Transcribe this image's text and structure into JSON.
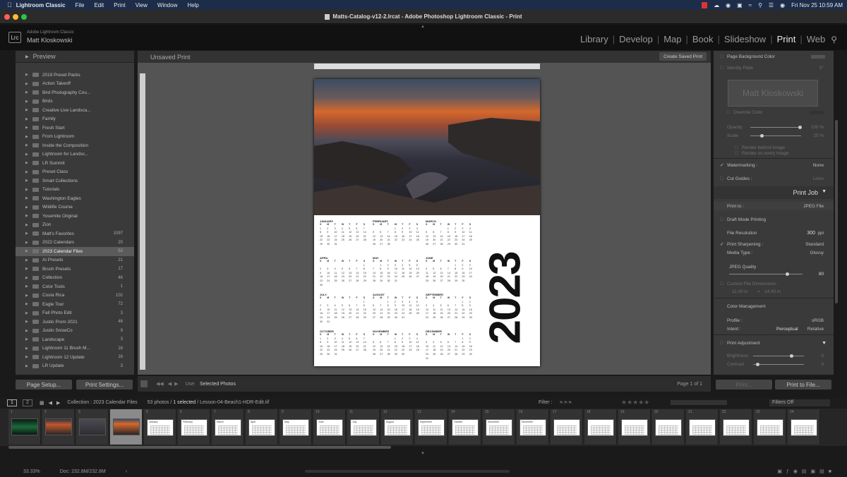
{
  "menubar": {
    "app": "Lightroom Classic",
    "items": [
      "File",
      "Edit",
      "Print",
      "View",
      "Window",
      "Help"
    ],
    "datetime": "Fri Nov 25  10:59 AM"
  },
  "window": {
    "title": "Matts-Catalog-v12-2.lrcat - Adobe Photoshop Lightroom Classic - Print"
  },
  "identity": {
    "badge": "Lrc",
    "product": "Adobe Lightroom Classic",
    "user": "Matt Kloskowski"
  },
  "modules": [
    "Library",
    "Develop",
    "Map",
    "Book",
    "Slideshow",
    "Print",
    "Web"
  ],
  "active_module": "Print",
  "left": {
    "header": "Preview",
    "collections": [
      {
        "name": "2019 Preset Packs",
        "count": ""
      },
      {
        "name": "Action Takeoff",
        "count": ""
      },
      {
        "name": "Bird Photography Cou...",
        "count": ""
      },
      {
        "name": "Birds",
        "count": ""
      },
      {
        "name": "Creative Live Landsca...",
        "count": ""
      },
      {
        "name": "Family",
        "count": ""
      },
      {
        "name": "Fresh Start",
        "count": ""
      },
      {
        "name": "From Lightroom",
        "count": ""
      },
      {
        "name": "Inside the Composition",
        "count": ""
      },
      {
        "name": "Lightroom for Landsc...",
        "count": ""
      },
      {
        "name": "LR Summit",
        "count": ""
      },
      {
        "name": "Preset Class",
        "count": ""
      },
      {
        "name": "Smart Collections",
        "count": ""
      },
      {
        "name": "Tutorials",
        "count": ""
      },
      {
        "name": "Washington Eagles",
        "count": ""
      },
      {
        "name": "Wildlife Course",
        "count": ""
      },
      {
        "name": "Yosemite Original",
        "count": ""
      },
      {
        "name": "Zion",
        "count": ""
      },
      {
        "name": "Matt's Favorites",
        "count": "1097"
      },
      {
        "name": "2022 Calendars",
        "count": "20"
      },
      {
        "name": "2023 Calendar Files",
        "count": "53"
      },
      {
        "name": "AI Presets",
        "count": "21"
      },
      {
        "name": "Brush Presets",
        "count": "17"
      },
      {
        "name": "Collection",
        "count": "46"
      },
      {
        "name": "Color Tools",
        "count": "1"
      },
      {
        "name": "Costa Rica",
        "count": "102"
      },
      {
        "name": "Eagle Tour",
        "count": "72"
      },
      {
        "name": "Fall Photo Edit",
        "count": "3"
      },
      {
        "name": "Justin Prom 2021",
        "count": "46"
      },
      {
        "name": "Justin SnowCo",
        "count": "9"
      },
      {
        "name": "Landscape",
        "count": "3"
      },
      {
        "name": "Lightroom 11 Brush M...",
        "count": "16"
      },
      {
        "name": "Lightroom 12 Update",
        "count": "16"
      },
      {
        "name": "LR Update",
        "count": "3"
      }
    ],
    "selected_index": 20,
    "page_setup": "Page Setup...",
    "print_settings": "Print Settings..."
  },
  "center": {
    "title": "Unsaved Print",
    "create_saved": "Create Saved Print",
    "year": "2023",
    "weekdays": [
      "S",
      "M",
      "T",
      "W",
      "T",
      "F",
      "S"
    ],
    "months": [
      {
        "name": "JANUARY",
        "start": 0,
        "days": 31
      },
      {
        "name": "FEBRUARY",
        "start": 3,
        "days": 28
      },
      {
        "name": "MARCH",
        "start": 3,
        "days": 31
      },
      {
        "name": "APRIL",
        "start": 6,
        "days": 30
      },
      {
        "name": "MAY",
        "start": 1,
        "days": 31
      },
      {
        "name": "JUNE",
        "start": 4,
        "days": 30
      },
      {
        "name": "JULY",
        "start": 6,
        "days": 31
      },
      {
        "name": "AUGUST",
        "start": 2,
        "days": 31
      },
      {
        "name": "SEPTEMBER",
        "start": 5,
        "days": 30
      },
      {
        "name": "OCTOBER",
        "start": 0,
        "days": 31
      },
      {
        "name": "NOVEMBER",
        "start": 3,
        "days": 30
      },
      {
        "name": "DECEMBER",
        "start": 5,
        "days": 31
      }
    ],
    "use_label": "Use:",
    "use_value": "Selected Photos",
    "page_info": "Page 1 of 1"
  },
  "right": {
    "page_bg": "Page Background Color",
    "identity_plate": "Identity Plate",
    "identity_plate_angle": "0°",
    "plate_text": "Matt Kloskowski",
    "override_color": "Override Color",
    "opacity_label": "Opacity",
    "opacity_value": "100 %",
    "scale_label": "Scale",
    "scale_value": "25 %",
    "render_behind": "Render behind image",
    "render_every": "Render on every image",
    "watermarking": "Watermarking :",
    "watermark_value": "None",
    "cut_guides": "Cut Guides :",
    "cut_guides_value": "Lines",
    "print_job": "Print Job",
    "print_to_label": "Print to :",
    "print_to_value": "JPEG File",
    "draft_mode": "Draft Mode Printing",
    "file_resolution": "File Resolution",
    "file_resolution_value": "300",
    "file_resolution_unit": "ppi",
    "print_sharpening": "Print Sharpening :",
    "print_sharpening_value": "Standard",
    "media_type": "Media Type :",
    "media_type_value": "Glossy",
    "jpeg_quality": "JPEG Quality",
    "jpeg_quality_value": "80",
    "jpeg_quality_fraction": 0.8,
    "custom_dims": "Custom File Dimensions :",
    "custom_w": "11.00 in",
    "custom_x": "×",
    "custom_h": "14.00 in",
    "color_management": "Color Management",
    "profile_label": "Profile :",
    "profile_value": "sRGB",
    "intent_label": "Intent :",
    "intent_perceptual": "Perceptual",
    "intent_relative": "Relative",
    "print_adjustment": "Print Adjustment",
    "brightness": "Brightness",
    "brightness_value": "0",
    "contrast": "Contrast",
    "contrast_value": "0",
    "print_btn": "Print...",
    "print_to_file_btn": "Print to File..."
  },
  "filmstrip": {
    "page1": "1",
    "page2": "2",
    "collection": "Collection : 2023 Calendar Files",
    "photos": "53 photos /",
    "selected": "1 selected",
    "filename": "/ Lesson-04-Beach1-HDR-Edit.tif",
    "filter_label": "Filter :",
    "filters_off": "Filters Off",
    "cells": [
      {
        "num": "1",
        "label": ""
      },
      {
        "num": "2",
        "label": ""
      },
      {
        "num": "3",
        "label": ""
      },
      {
        "num": "4",
        "label": ""
      },
      {
        "num": "5",
        "label": "January"
      },
      {
        "num": "6",
        "label": "February"
      },
      {
        "num": "7",
        "label": "March"
      },
      {
        "num": "8",
        "label": "April"
      },
      {
        "num": "9",
        "label": "May"
      },
      {
        "num": "10",
        "label": "June"
      },
      {
        "num": "11",
        "label": "July"
      },
      {
        "num": "12",
        "label": "August"
      },
      {
        "num": "13",
        "label": "September"
      },
      {
        "num": "14",
        "label": "October"
      },
      {
        "num": "15",
        "label": "November"
      },
      {
        "num": "16",
        "label": "December"
      },
      {
        "num": "17",
        "label": ""
      },
      {
        "num": "18",
        "label": ""
      },
      {
        "num": "19",
        "label": ""
      },
      {
        "num": "20",
        "label": ""
      },
      {
        "num": "21",
        "label": ""
      },
      {
        "num": "22",
        "label": ""
      },
      {
        "num": "23",
        "label": ""
      },
      {
        "num": "24",
        "label": ""
      }
    ]
  },
  "status": {
    "zoom": "33.33%",
    "doc": "Doc: 232.8M/232.8M"
  }
}
